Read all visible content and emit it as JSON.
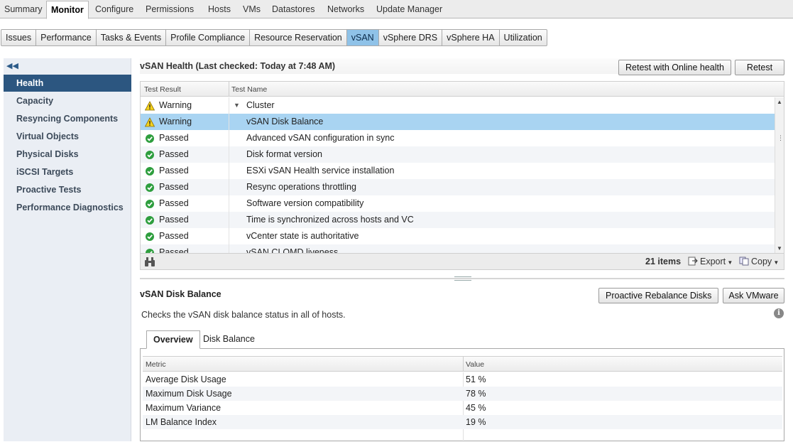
{
  "top_tabs": [
    "Summary",
    "Monitor",
    "Configure",
    "Permissions",
    "Hosts",
    "VMs",
    "Datastores",
    "Networks",
    "Update Manager"
  ],
  "sub_tabs": [
    "Issues",
    "Performance",
    "Tasks & Events",
    "Profile Compliance",
    "Resource Reservation",
    "vSAN",
    "vSphere DRS",
    "vSphere HA",
    "Utilization"
  ],
  "nav": {
    "collapse_icon": "double-chevron-left-icon",
    "items": [
      "Health",
      "Capacity",
      "Resyncing Components",
      "Virtual Objects",
      "Physical Disks",
      "iSCSI Targets",
      "Proactive Tests",
      "Performance Diagnostics"
    ]
  },
  "health": {
    "title": "vSAN Health (Last checked: Today at 7:48 AM)",
    "retest_online_label": "Retest with Online health",
    "retest_label": "Retest",
    "columns": [
      "Test Result",
      "Test Name"
    ],
    "rows": [
      {
        "result": "Warning",
        "name": "Cluster",
        "status": "warning"
      },
      {
        "result": "Warning",
        "name": "vSAN Disk Balance",
        "status": "warning"
      },
      {
        "result": "Passed",
        "name": "Advanced vSAN configuration in sync",
        "status": "passed"
      },
      {
        "result": "Passed",
        "name": "Disk format version",
        "status": "passed"
      },
      {
        "result": "Passed",
        "name": "ESXi vSAN Health service installation",
        "status": "passed"
      },
      {
        "result": "Passed",
        "name": "Resync operations throttling",
        "status": "passed"
      },
      {
        "result": "Passed",
        "name": "Software version compatibility",
        "status": "passed"
      },
      {
        "result": "Passed",
        "name": "Time is synchronized across hosts and VC",
        "status": "passed"
      },
      {
        "result": "Passed",
        "name": "vCenter state is authoritative",
        "status": "passed"
      },
      {
        "result": "Passed",
        "name": "vSAN CLOMD liveness",
        "status": "passed"
      }
    ],
    "item_count": "21 items",
    "export_label": "Export",
    "copy_label": "Copy"
  },
  "detail": {
    "title": "vSAN Disk Balance",
    "rebalance_label": "Proactive Rebalance Disks",
    "ask_label": "Ask VMware",
    "description": "Checks the vSAN disk balance status in all of hosts.",
    "tabs": [
      "Overview",
      "Disk Balance"
    ],
    "columns": [
      "Metric",
      "Value"
    ],
    "metrics": [
      {
        "metric": "Average Disk Usage",
        "value": "51 %"
      },
      {
        "metric": "Maximum Disk Usage",
        "value": "78 %"
      },
      {
        "metric": "Maximum Variance",
        "value": "45 %"
      },
      {
        "metric": "LM Balance Index",
        "value": "19 %"
      }
    ]
  },
  "colors": {
    "selected_nav": "#2c5680",
    "selected_row": "#a9d4f2",
    "active_subtab": "#8fc2e8",
    "warning": "#f5d31e",
    "passed": "#2e9e3e"
  }
}
